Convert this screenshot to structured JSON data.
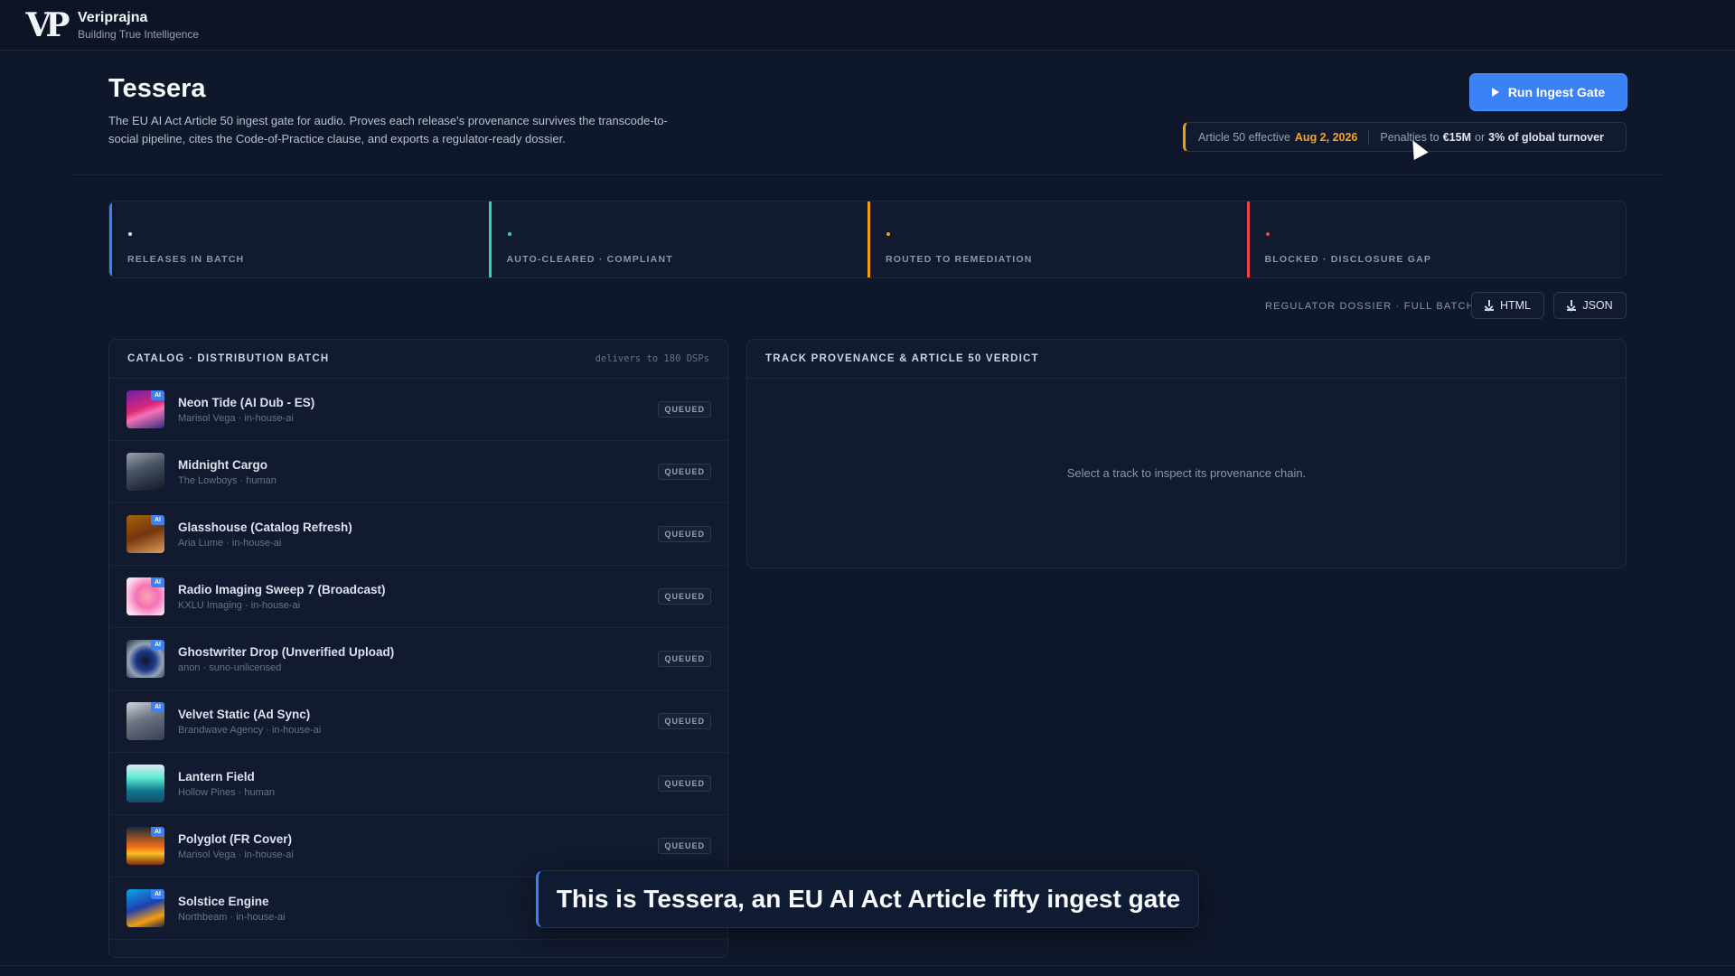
{
  "header": {
    "logo_text": "VP",
    "brand_name": "Veriprajna",
    "brand_tagline": "Building True Intelligence"
  },
  "page": {
    "title": "Tessera",
    "description": "The EU AI Act Article 50 ingest gate for audio. Proves each release's provenance survives the transcode-to-social pipeline, cites the Code-of-Practice clause, and exports a regulator-ready dossier.",
    "run_button_label": "Run Ingest Gate"
  },
  "notice": {
    "effective_prefix": "Article 50 effective",
    "effective_date": "Aug 2, 2026",
    "penalties_prefix": "Penalties to",
    "penalty_amount": "€15M",
    "or_text": "or",
    "penalty_turnover": "3% of global turnover"
  },
  "stats": [
    {
      "label": "RELEASES IN BATCH",
      "color": "#3b82f6"
    },
    {
      "label": "AUTO-CLEARED · COMPLIANT",
      "color": "#2dd4bf"
    },
    {
      "label": "ROUTED TO REMEDIATION",
      "color": "#f59e0b"
    },
    {
      "label": "BLOCKED · DISCLOSURE GAP",
      "color": "#ef4444"
    }
  ],
  "dossier": {
    "label": "REGULATOR DOSSIER · FULL BATCH",
    "html_label": "HTML",
    "json_label": "JSON"
  },
  "catalog": {
    "title": "CATALOG · DISTRIBUTION BATCH",
    "meta": "delivers to 180 DSPs",
    "status_label": "QUEUED",
    "ai_badge_label": "AI",
    "tracks": [
      {
        "title": "Neon Tide (AI Dub - ES)",
        "subtitle": "Marisol Vega · in-house-ai",
        "ai": true
      },
      {
        "title": "Midnight Cargo",
        "subtitle": "The Lowboys · human",
        "ai": false
      },
      {
        "title": "Glasshouse (Catalog Refresh)",
        "subtitle": "Aria Lume · in-house-ai",
        "ai": true
      },
      {
        "title": "Radio Imaging Sweep 7 (Broadcast)",
        "subtitle": "KXLU Imaging · in-house-ai",
        "ai": true
      },
      {
        "title": "Ghostwriter Drop (Unverified Upload)",
        "subtitle": "anon · suno-unlicensed",
        "ai": true
      },
      {
        "title": "Velvet Static (Ad Sync)",
        "subtitle": "Brandwave Agency · in-house-ai",
        "ai": true
      },
      {
        "title": "Lantern Field",
        "subtitle": "Hollow Pines · human",
        "ai": false
      },
      {
        "title": "Polyglot (FR Cover)",
        "subtitle": "Marisol Vega · in-house-ai",
        "ai": true
      },
      {
        "title": "Solstice Engine",
        "subtitle": "Northbeam · in-house-ai",
        "ai": true
      }
    ]
  },
  "verdict": {
    "title": "TRACK PROVENANCE & ARTICLE 50 VERDICT",
    "empty_text": "Select a track to inspect its provenance chain."
  },
  "caption": {
    "text": "This is Tessera, an EU AI Act Article fifty ingest gate"
  }
}
